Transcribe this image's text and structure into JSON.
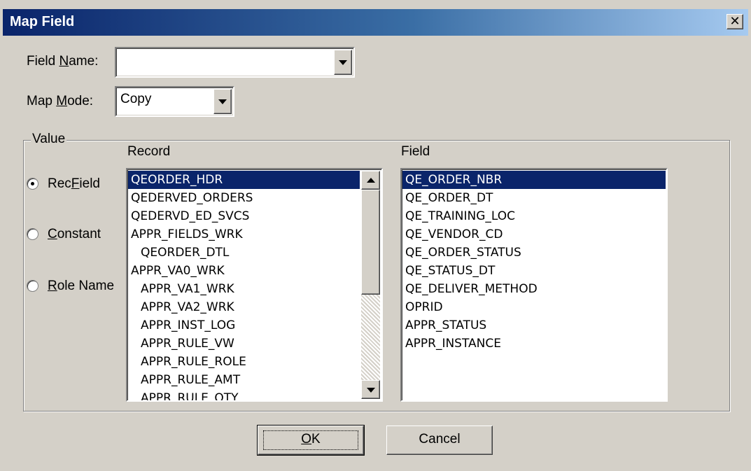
{
  "window": {
    "title": "Map Field",
    "close_glyph": "✕"
  },
  "field_name": {
    "label_pre": "Field ",
    "label_accel": "N",
    "label_post": "ame:",
    "value": ""
  },
  "map_mode": {
    "label_pre": "Map ",
    "label_accel": "M",
    "label_post": "ode:",
    "value": "Copy"
  },
  "value_group": {
    "legend": "Value",
    "options": [
      {
        "pre": "Rec",
        "accel": "F",
        "post": "ield",
        "checked": true
      },
      {
        "pre": "",
        "accel": "C",
        "post": "onstant",
        "checked": false
      },
      {
        "pre": "",
        "accel": "R",
        "post": "ole Name",
        "checked": false
      }
    ]
  },
  "record": {
    "header": "Record",
    "items": [
      "QEORDER_HDR",
      "QEDERVED_ORDERS",
      "QEDERVD_ED_SVCS",
      "APPR_FIELDS_WRK",
      "QEORDER_DTL",
      "APPR_VA0_WRK",
      "APPR_VA1_WRK",
      "APPR_VA2_WRK",
      "APPR_INST_LOG",
      "APPR_RULE_VW",
      "APPR_RULE_ROLE",
      "APPR_RULE_AMT",
      "APPR_RULE_QTY"
    ],
    "selected_index": 0
  },
  "field": {
    "header": "Field",
    "items": [
      "QE_ORDER_NBR",
      "QE_ORDER_DT",
      "QE_TRAINING_LOC",
      "QE_VENDOR_CD",
      "QE_ORDER_STATUS",
      "QE_STATUS_DT",
      "QE_DELIVER_METHOD",
      "OPRID",
      "APPR_STATUS",
      "APPR_INSTANCE"
    ],
    "selected_index": 0
  },
  "buttons": {
    "ok": {
      "accel": "O",
      "post": "K"
    },
    "cancel": {
      "label": "Cancel"
    }
  },
  "colors": {
    "face": "#d4d0c8",
    "selection": "#0a246a",
    "title_start": "#0a246a",
    "title_end": "#a6caf0"
  }
}
